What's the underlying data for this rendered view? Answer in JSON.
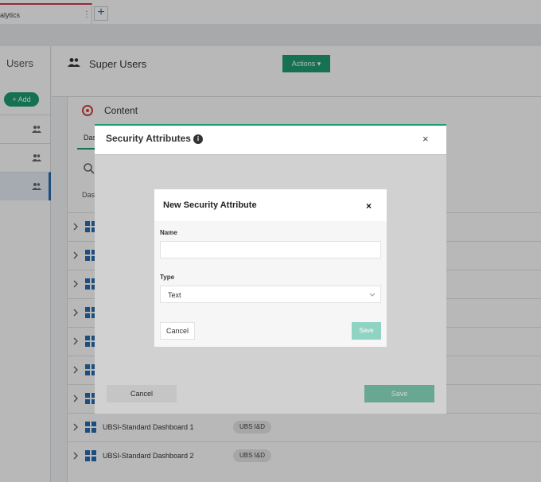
{
  "browser": {
    "tab_title": "alytics",
    "tab_menu": "⋮",
    "new_tab": "+"
  },
  "left_panel": {
    "title": "Users",
    "add_label": "+ Add"
  },
  "header": {
    "title": "Super Users",
    "actions_label": "Actions ▾"
  },
  "content": {
    "title": "Content",
    "tab_label": "Das",
    "column_header": "Das",
    "rows": [
      {
        "name": "",
        "badge": ""
      },
      {
        "name": "",
        "badge": ""
      },
      {
        "name": "",
        "badge": ""
      },
      {
        "name": "",
        "badge": ""
      },
      {
        "name": "",
        "badge": ""
      },
      {
        "name": "",
        "badge": ""
      },
      {
        "name": "",
        "badge": ""
      },
      {
        "name": "UBSI-Standard Dashboard 1",
        "badge": "UBS I&D"
      },
      {
        "name": "UBSI-Standard Dashboard 2",
        "badge": "UBS I&D"
      }
    ]
  },
  "security_dialog": {
    "title": "Security Attributes",
    "info_glyph": "i",
    "close_glyph": "×",
    "cancel_label": "Cancel",
    "save_label": "Save"
  },
  "new_attribute_dialog": {
    "title": "New Security Attribute",
    "close_glyph": "×",
    "name_label": "Name",
    "name_value": "",
    "type_label": "Type",
    "type_value": "Text",
    "cancel_label": "Cancel",
    "save_label": "Save"
  },
  "colors": {
    "accent": "#1f9d74",
    "tab_accent": "#d23b54",
    "save_disabled": "#8fd3c3"
  }
}
